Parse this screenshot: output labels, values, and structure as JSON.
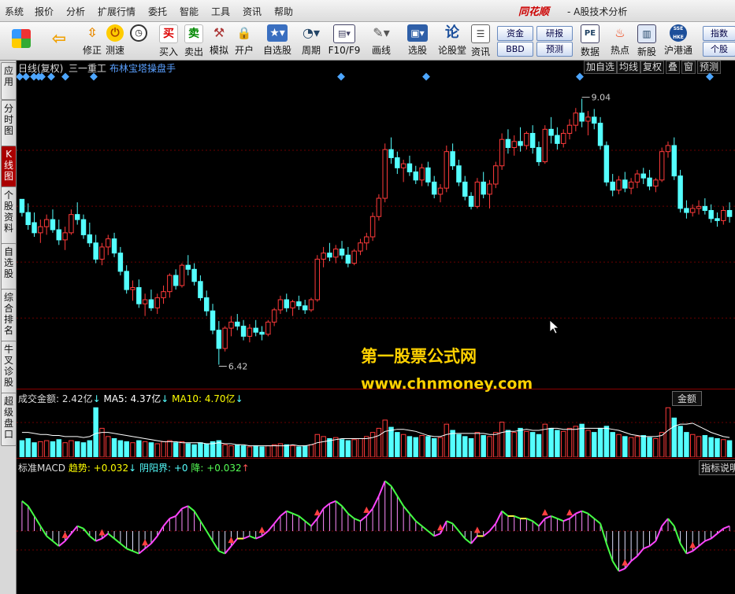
{
  "menu": {
    "items": [
      "系统",
      "报价",
      "分析",
      "扩展行情",
      "委托",
      "智能",
      "工具",
      "资讯",
      "帮助"
    ],
    "brand": "同花顺",
    "app_title": "- A股技术分析"
  },
  "toolbar": {
    "buttons": [
      {
        "label": "",
        "icon": "windows-icon"
      },
      {
        "label": "",
        "icon": "back-arrow-icon"
      },
      {
        "label": "修正",
        "icon": "up-down-arrow-icon"
      },
      {
        "label": "测速",
        "icon": "clock-icon"
      },
      {
        "label": "买入",
        "icon": "buy-icon",
        "glyph": "买"
      },
      {
        "label": "卖出",
        "icon": "sell-icon",
        "glyph": "卖"
      },
      {
        "label": "模拟",
        "icon": "hammer-icon"
      },
      {
        "label": "开户",
        "icon": "lock-icon"
      },
      {
        "label": "自选股",
        "icon": "star-icon"
      },
      {
        "label": "周期",
        "icon": "period-icon"
      },
      {
        "label": "F10/F9",
        "icon": "f10-icon"
      },
      {
        "label": "画线",
        "icon": "pencil-icon"
      },
      {
        "label": "选股",
        "icon": "select-icon"
      },
      {
        "label": "论股堂",
        "icon": "forum-icon",
        "glyph": "论"
      },
      {
        "label": "资讯",
        "icon": "news-icon"
      }
    ],
    "pill_buttons": [
      "资金",
      "BBD",
      "研报",
      "预测"
    ],
    "right_buttons": [
      {
        "label": "数据",
        "icon": "pe-icon",
        "glyph": "PE"
      },
      {
        "label": "热点",
        "icon": "hot-icon"
      },
      {
        "label": "新股",
        "icon": "newstock-icon"
      },
      {
        "label": "沪港通",
        "icon": "hk-connect-icon",
        "glyph": "SSE HKE"
      }
    ],
    "far_right": [
      "指数",
      "个股"
    ]
  },
  "sidebar": {
    "tabs": [
      "应用",
      "分时图",
      "K线图",
      "个股资料",
      "自选股",
      "综合排名",
      "牛叉诊股",
      "超级盘口"
    ],
    "active": 2
  },
  "chart_header": {
    "period": "日线(复权)",
    "stock_name": "三一重工",
    "indicator": "布林宝塔操盘手",
    "right_buttons": [
      "加自选",
      "均线",
      "复权",
      "叠",
      "窗",
      "预测"
    ]
  },
  "price": {
    "high_label": "9.04",
    "low_label": "6.42"
  },
  "volume": {
    "label": "成交金额: 2.42亿",
    "ma5": "MA5: 4.37亿",
    "ma10": "MA10: 4.70亿",
    "arrow": "↓",
    "right_label": "金额"
  },
  "macd": {
    "label": "标准MACD",
    "trend": "趋势: +0.032",
    "yinyang": "阴阳界: +0",
    "fall": "降: +0.032",
    "right_label": "指标说明"
  },
  "watermark": {
    "line1": "第一股票公式网",
    "line2": "www.chnmoney.com"
  },
  "colors": {
    "up": "#ff3a3a",
    "down": "#54ffff",
    "accent_diamond": "#4da6ff",
    "ma": "#ffffff",
    "macd_up": "#ff44ff",
    "macd_down": "#44ff44",
    "macd_mid": "#ffff44"
  },
  "chart_data": {
    "type": "candlestick",
    "ohlc": [
      [
        8.05,
        8.05,
        7.88,
        7.92
      ],
      [
        7.92,
        8.01,
        7.75,
        7.8
      ],
      [
        7.82,
        7.92,
        7.68,
        7.72
      ],
      [
        7.72,
        7.85,
        7.62,
        7.78
      ],
      [
        7.78,
        7.9,
        7.7,
        7.85
      ],
      [
        7.85,
        7.95,
        7.72,
        7.75
      ],
      [
        7.75,
        7.85,
        7.6,
        7.65
      ],
      [
        7.65,
        7.78,
        7.55,
        7.72
      ],
      [
        7.72,
        7.95,
        7.7,
        7.9
      ],
      [
        7.9,
        8.02,
        7.8,
        7.85
      ],
      [
        7.85,
        7.9,
        7.66,
        7.7
      ],
      [
        7.7,
        7.82,
        7.58,
        7.62
      ],
      [
        7.62,
        7.7,
        7.42,
        7.46
      ],
      [
        7.46,
        7.62,
        7.4,
        7.58
      ],
      [
        7.58,
        7.7,
        7.5,
        7.66
      ],
      [
        7.66,
        7.72,
        7.48,
        7.52
      ],
      [
        7.52,
        7.58,
        7.3,
        7.34
      ],
      [
        7.34,
        7.4,
        7.12,
        7.16
      ],
      [
        7.16,
        7.25,
        7.05,
        7.18
      ],
      [
        7.18,
        7.26,
        6.98,
        7.02
      ],
      [
        7.02,
        7.12,
        6.9,
        7.06
      ],
      [
        7.06,
        7.16,
        6.95,
        6.98
      ],
      [
        6.98,
        7.12,
        6.92,
        7.08
      ],
      [
        7.08,
        7.2,
        7.02,
        7.14
      ],
      [
        7.14,
        7.32,
        7.08,
        7.3
      ],
      [
        7.3,
        7.36,
        7.16,
        7.2
      ],
      [
        7.2,
        7.42,
        7.18,
        7.4
      ],
      [
        7.4,
        7.5,
        7.3,
        7.36
      ],
      [
        7.36,
        7.42,
        7.2,
        7.24
      ],
      [
        7.24,
        7.3,
        7.05,
        7.08
      ],
      [
        7.08,
        7.15,
        6.9,
        6.95
      ],
      [
        6.95,
        7.02,
        6.72,
        6.76
      ],
      [
        6.76,
        6.85,
        6.42,
        6.58
      ],
      [
        6.58,
        6.8,
        6.55,
        6.78
      ],
      [
        6.78,
        6.9,
        6.7,
        6.84
      ],
      [
        6.84,
        6.92,
        6.76,
        6.8
      ],
      [
        6.8,
        6.86,
        6.66,
        6.7
      ],
      [
        6.7,
        6.82,
        6.64,
        6.78
      ],
      [
        6.78,
        6.86,
        6.7,
        6.74
      ],
      [
        6.74,
        6.8,
        6.66,
        6.72
      ],
      [
        6.72,
        6.86,
        6.7,
        6.84
      ],
      [
        6.84,
        6.98,
        6.8,
        6.96
      ],
      [
        6.96,
        7.1,
        6.92,
        7.06
      ],
      [
        7.06,
        7.12,
        6.94,
        6.98
      ],
      [
        6.98,
        7.06,
        6.9,
        7.04
      ],
      [
        7.04,
        7.1,
        6.96,
        7.0
      ],
      [
        7.0,
        7.06,
        6.92,
        6.96
      ],
      [
        6.96,
        7.08,
        6.94,
        7.06
      ],
      [
        7.06,
        7.5,
        7.04,
        7.46
      ],
      [
        7.46,
        7.58,
        7.38,
        7.52
      ],
      [
        7.52,
        7.62,
        7.44,
        7.48
      ],
      [
        7.48,
        7.6,
        7.42,
        7.56
      ],
      [
        7.56,
        7.64,
        7.46,
        7.5
      ],
      [
        7.5,
        7.58,
        7.38,
        7.42
      ],
      [
        7.42,
        7.56,
        7.4,
        7.54
      ],
      [
        7.54,
        7.66,
        7.5,
        7.62
      ],
      [
        7.62,
        7.72,
        7.55,
        7.68
      ],
      [
        7.68,
        7.92,
        7.64,
        7.88
      ],
      [
        7.88,
        8.1,
        7.84,
        8.06
      ],
      [
        8.06,
        8.6,
        8.02,
        8.54
      ],
      [
        8.54,
        8.66,
        8.4,
        8.46
      ],
      [
        8.46,
        8.52,
        8.3,
        8.36
      ],
      [
        8.36,
        8.44,
        8.22,
        8.4
      ],
      [
        8.4,
        8.48,
        8.28,
        8.32
      ],
      [
        8.32,
        8.38,
        8.2,
        8.24
      ],
      [
        8.24,
        8.4,
        8.18,
        8.36
      ],
      [
        8.36,
        8.42,
        8.18,
        8.22
      ],
      [
        8.22,
        8.28,
        8.06,
        8.1
      ],
      [
        8.1,
        8.2,
        8.02,
        8.16
      ],
      [
        8.16,
        8.58,
        8.12,
        8.52
      ],
      [
        8.52,
        8.6,
        8.34,
        8.38
      ],
      [
        8.38,
        8.44,
        8.18,
        8.22
      ],
      [
        8.22,
        8.28,
        8.04,
        8.08
      ],
      [
        8.08,
        8.12,
        7.95,
        7.98
      ],
      [
        7.98,
        8.26,
        7.96,
        8.22
      ],
      [
        8.22,
        8.32,
        8.06,
        8.1
      ],
      [
        8.1,
        8.24,
        7.96,
        8.2
      ],
      [
        8.2,
        8.42,
        8.16,
        8.38
      ],
      [
        8.38,
        8.7,
        8.34,
        8.64
      ],
      [
        8.64,
        8.74,
        8.5,
        8.56
      ],
      [
        8.56,
        8.68,
        8.48,
        8.62
      ],
      [
        8.62,
        8.76,
        8.52,
        8.58
      ],
      [
        8.58,
        8.72,
        8.54,
        8.7
      ],
      [
        8.7,
        8.78,
        8.5,
        8.56
      ],
      [
        8.56,
        8.62,
        8.38,
        8.42
      ],
      [
        8.42,
        8.78,
        8.4,
        8.74
      ],
      [
        8.74,
        8.86,
        8.6,
        8.68
      ],
      [
        8.68,
        8.76,
        8.54,
        8.6
      ],
      [
        8.6,
        8.74,
        8.56,
        8.7
      ],
      [
        8.7,
        8.84,
        8.64,
        8.78
      ],
      [
        8.78,
        8.95,
        8.72,
        8.9
      ],
      [
        8.9,
        9.04,
        8.76,
        8.82
      ],
      [
        8.82,
        8.92,
        8.68,
        8.86
      ],
      [
        8.86,
        8.94,
        8.74,
        8.8
      ],
      [
        8.8,
        8.86,
        8.54,
        8.58
      ],
      [
        8.58,
        8.62,
        8.18,
        8.22
      ],
      [
        8.22,
        8.3,
        8.08,
        8.14
      ],
      [
        8.14,
        8.28,
        8.1,
        8.24
      ],
      [
        8.24,
        8.32,
        8.12,
        8.16
      ],
      [
        8.16,
        8.26,
        8.1,
        8.22
      ],
      [
        8.22,
        8.34,
        8.16,
        8.3
      ],
      [
        8.3,
        8.36,
        8.2,
        8.26
      ],
      [
        8.26,
        8.34,
        8.14,
        8.18
      ],
      [
        8.18,
        8.26,
        8.12,
        8.24
      ],
      [
        8.24,
        8.56,
        8.22,
        8.52
      ],
      [
        8.52,
        8.62,
        8.46,
        8.58
      ],
      [
        8.58,
        8.66,
        8.24,
        8.28
      ],
      [
        8.28,
        8.34,
        7.92,
        7.96
      ],
      [
        7.96,
        8.04,
        7.86,
        7.92
      ],
      [
        7.92,
        8.0,
        7.88,
        7.96
      ],
      [
        7.96,
        8.04,
        7.9,
        7.98
      ],
      [
        7.98,
        8.06,
        7.9,
        7.94
      ],
      [
        7.94,
        8.0,
        7.82,
        7.86
      ],
      [
        7.86,
        7.92,
        7.78,
        7.84
      ],
      [
        7.84,
        7.98,
        7.8,
        7.94
      ],
      [
        7.94,
        8.02,
        7.82,
        7.88
      ]
    ],
    "volume": [
      1.6,
      1.8,
      1.4,
      1.5,
      1.6,
      1.5,
      1.7,
      1.4,
      1.6,
      1.5,
      1.4,
      1.6,
      4.8,
      2.8,
      2.0,
      1.8,
      1.6,
      1.5,
      1.4,
      1.6,
      1.5,
      1.4,
      1.3,
      1.5,
      1.6,
      1.4,
      1.5,
      1.3,
      1.2,
      1.4,
      1.3,
      1.5,
      1.6,
      1.2,
      1.1,
      1.2,
      1.1,
      1.0,
      1.1,
      1.0,
      1.1,
      1.2,
      1.3,
      1.2,
      1.1,
      1.0,
      1.1,
      1.2,
      2.2,
      2.0,
      1.8,
      1.9,
      1.7,
      1.6,
      1.7,
      1.8,
      2.0,
      2.4,
      2.8,
      3.6,
      2.9,
      2.4,
      2.2,
      2.0,
      1.9,
      2.1,
      2.0,
      1.8,
      1.9,
      3.2,
      2.6,
      2.2,
      2.0,
      1.8,
      2.4,
      2.1,
      2.0,
      2.4,
      3.4,
      2.6,
      2.4,
      2.8,
      2.5,
      2.4,
      2.2,
      3.2,
      2.8,
      2.6,
      2.5,
      2.8,
      3.0,
      3.2,
      2.6,
      2.4,
      2.8,
      3.0,
      2.4,
      2.2,
      2.0,
      1.9,
      2.0,
      2.1,
      1.9,
      1.8,
      2.4,
      4.8,
      3.8,
      3.0,
      2.4,
      2.2,
      2.0,
      2.1,
      1.9,
      1.8,
      1.7,
      1.6
    ],
    "ma_volume": [
      2.4,
      2.4,
      2.3,
      2.2,
      2.2,
      2.1,
      2.1,
      2.0,
      2.0,
      2.0,
      1.9,
      2.0,
      2.3,
      2.4,
      2.4,
      2.3,
      2.2,
      2.1,
      2.0,
      1.9,
      1.8,
      1.7,
      1.6,
      1.5,
      1.5,
      1.5,
      1.4,
      1.4,
      1.4,
      1.4,
      1.3,
      1.3,
      1.4,
      1.3,
      1.3,
      1.2,
      1.2,
      1.1,
      1.1,
      1.1,
      1.1,
      1.1,
      1.1,
      1.1,
      1.2,
      1.1,
      1.1,
      1.2,
      1.4,
      1.5,
      1.6,
      1.7,
      1.8,
      1.8,
      1.8,
      1.8,
      1.8,
      1.9,
      2.1,
      2.5,
      2.6,
      2.7,
      2.7,
      2.6,
      2.5,
      2.3,
      2.1,
      2.0,
      2.0,
      2.2,
      2.3,
      2.3,
      2.3,
      2.3,
      2.3,
      2.3,
      2.2,
      2.2,
      2.4,
      2.5,
      2.5,
      2.6,
      2.7,
      2.6,
      2.6,
      2.7,
      2.8,
      2.8,
      2.7,
      2.7,
      2.7,
      2.8,
      2.8,
      2.8,
      2.8,
      2.8,
      2.7,
      2.6,
      2.4,
      2.2,
      2.1,
      2.0,
      2.0,
      2.0,
      2.1,
      2.6,
      3.0,
      3.2,
      3.2,
      3.3,
      3.0,
      2.7,
      2.4,
      2.2,
      2.0,
      1.9
    ],
    "macd_hist": [
      0.12,
      0.1,
      0.06,
      0.02,
      -0.02,
      -0.04,
      -0.06,
      -0.04,
      -0.01,
      0.02,
      0.01,
      -0.02,
      -0.04,
      -0.03,
      -0.01,
      -0.03,
      -0.05,
      -0.07,
      -0.08,
      -0.09,
      -0.07,
      -0.05,
      -0.02,
      0.02,
      0.05,
      0.06,
      0.09,
      0.1,
      0.08,
      0.04,
      0.0,
      -0.04,
      -0.08,
      -0.09,
      -0.06,
      -0.03,
      -0.03,
      -0.02,
      -0.03,
      -0.02,
      0.0,
      0.03,
      0.06,
      0.08,
      0.07,
      0.06,
      0.04,
      0.02,
      0.05,
      0.09,
      0.11,
      0.12,
      0.1,
      0.07,
      0.05,
      0.04,
      0.06,
      0.09,
      0.14,
      0.2,
      0.18,
      0.14,
      0.1,
      0.07,
      0.04,
      0.02,
      0.0,
      -0.02,
      -0.01,
      0.04,
      0.03,
      0.0,
      -0.03,
      -0.05,
      -0.02,
      -0.02,
      0.0,
      0.03,
      0.08,
      0.06,
      0.06,
      0.05,
      0.05,
      0.04,
      0.02,
      0.05,
      0.06,
      0.05,
      0.04,
      0.05,
      0.07,
      0.08,
      0.07,
      0.05,
      0.03,
      -0.05,
      -0.12,
      -0.16,
      -0.15,
      -0.12,
      -0.1,
      -0.07,
      -0.06,
      -0.04,
      0.02,
      0.05,
      0.02,
      -0.05,
      -0.09,
      -0.08,
      -0.06,
      -0.04,
      -0.03,
      -0.01,
      0.01,
      0.02
    ],
    "y_range": [
      6.3,
      9.2
    ]
  }
}
